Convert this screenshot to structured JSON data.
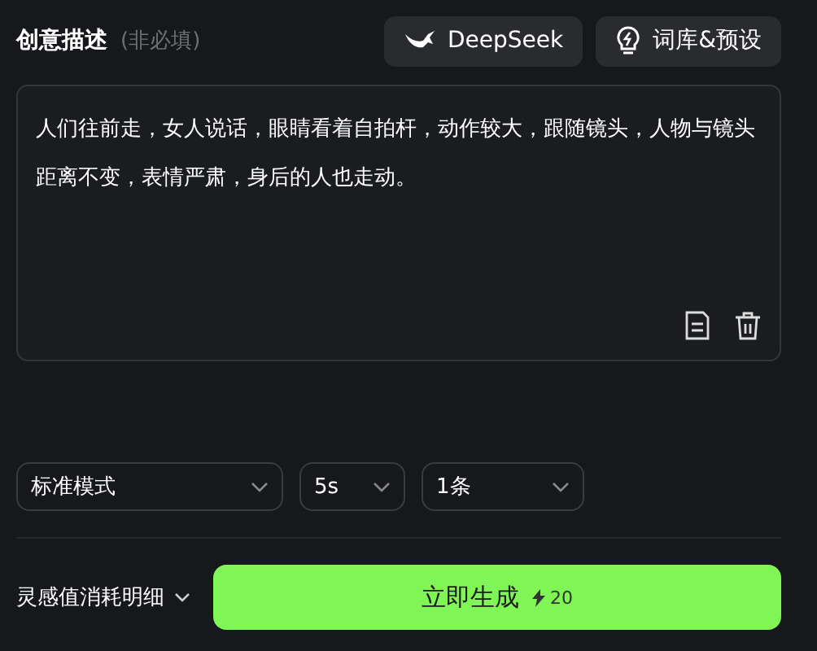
{
  "header": {
    "title": "创意描述",
    "hint": "(非必填)",
    "buttons": [
      {
        "kind": "deepseek",
        "label": "DeepSeek"
      },
      {
        "kind": "library",
        "label": "词库&预设"
      }
    ]
  },
  "prompt": {
    "value": "人们往前走，女人说话，眼睛看着自拍杆，动作较大，跟随镜头，人物与镜头距离不变，表情严肃，身后的人也走动。"
  },
  "options": [
    {
      "value": "标准模式",
      "kind": "wide"
    },
    {
      "value": "5s",
      "kind": "narrow"
    },
    {
      "value": "1条",
      "kind": "medium"
    }
  ],
  "footer": {
    "cost_details": "灵感值消耗明细",
    "generate": {
      "label": "立即生成",
      "cost": "20"
    }
  }
}
